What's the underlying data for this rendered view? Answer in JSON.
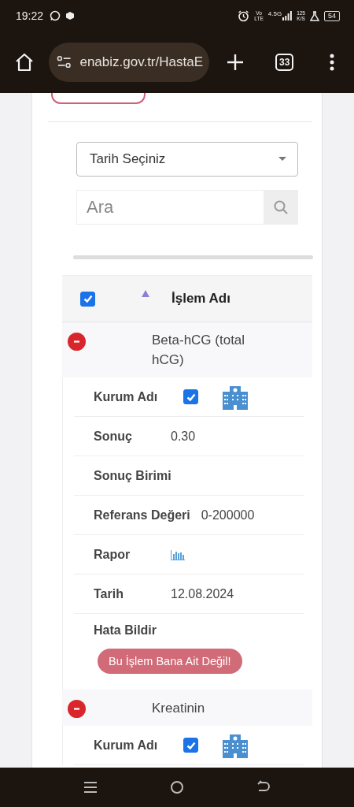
{
  "status_bar": {
    "time": "19:22",
    "volte": [
      "Vo",
      "LTE"
    ],
    "network_type": "4.5G",
    "data_speed": [
      "125",
      "K/S"
    ],
    "battery": "54"
  },
  "browser": {
    "url": "enabiz.gov.tr/HastaE",
    "tab_count": "33"
  },
  "filters": {
    "date_select": {
      "value": "Tarih Seçiniz"
    },
    "search": {
      "placeholder": "Ara"
    }
  },
  "table": {
    "all_checked": true,
    "sort_ascending": true,
    "column": "İşlem Adı",
    "rows": [
      {
        "name": "Beta-hCG (total hCG)",
        "expanded": true,
        "details": [
          {
            "kind": "institution",
            "label": "Kurum Adı",
            "checked": true
          },
          {
            "kind": "text",
            "label": "Sonuç",
            "value": "0.30"
          },
          {
            "kind": "text",
            "label": "Sonuç Birimi"
          },
          {
            "kind": "text",
            "label": "Referans Değeri",
            "value": "0-200000"
          },
          {
            "kind": "report",
            "label": "Rapor"
          },
          {
            "kind": "text",
            "label": "Tarih",
            "value": "12.08.2024"
          },
          {
            "kind": "action",
            "label": "Hata Bildir",
            "button": "Bu İşlem Bana Ait Değil!"
          }
        ]
      },
      {
        "name": "Kreatinin",
        "expanded": true,
        "details": [
          {
            "kind": "institution",
            "label": "Kurum Adı",
            "checked": true
          }
        ]
      }
    ]
  }
}
